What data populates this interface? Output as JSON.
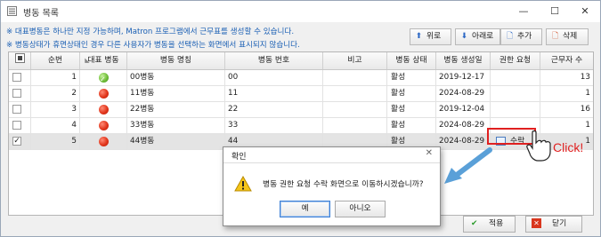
{
  "window": {
    "title": "병동 목록",
    "icon": "list-icon"
  },
  "notes": [
    "※ 대표병동은 하나만 지정 가능하며, Matron 프로그램에서 근무표를 생성할 수 있습니다.",
    "※ 병동상태가 휴면상태인 경우 다른 사용자가 병동을 선택하는 화면에서 표시되지 않습니다."
  ],
  "toolbar": {
    "up": "위로",
    "down": "아래로",
    "add": "추가",
    "delete": "삭제"
  },
  "table": {
    "headers": [
      "■",
      "순번",
      "대표 병동",
      "병동 명칭",
      "병동 번호",
      "비고",
      "병동 상태",
      "병동 생성일",
      "권한 요청",
      "근무자 수"
    ],
    "rows": [
      {
        "checked": false,
        "no": "1",
        "rep": "green",
        "name": "00병동",
        "ward_no": "00",
        "note": "",
        "status": "활성",
        "created": "2019-12-17",
        "request": "",
        "workers": "13"
      },
      {
        "checked": false,
        "no": "2",
        "rep": "red",
        "name": "11병동",
        "ward_no": "11",
        "note": "",
        "status": "활성",
        "created": "2024-08-29",
        "request": "",
        "workers": "1"
      },
      {
        "checked": false,
        "no": "3",
        "rep": "red",
        "name": "22병동",
        "ward_no": "22",
        "note": "",
        "status": "활성",
        "created": "2019-12-04",
        "request": "",
        "workers": "16"
      },
      {
        "checked": false,
        "no": "4",
        "rep": "red",
        "name": "33병동",
        "ward_no": "33",
        "note": "",
        "status": "활성",
        "created": "2024-08-29",
        "request": "",
        "workers": "1"
      },
      {
        "checked": true,
        "no": "5",
        "rep": "red",
        "name": "44병동",
        "ward_no": "44",
        "note": "",
        "status": "활성",
        "created": "2024-08-29",
        "request": "수락",
        "workers": "1"
      }
    ]
  },
  "dialog": {
    "title": "확인",
    "message": "병동 권한 요청 수락 화면으로 이동하시겠습니까?",
    "yes": "예",
    "no": "아니오",
    "icon": "warning-icon"
  },
  "footer": {
    "apply": "적용",
    "close": "닫기"
  },
  "annotation": {
    "click_text": "Click!"
  },
  "colors": {
    "note_blue": "#1a5fb4",
    "accent_red": "#e02020",
    "arrow_blue": "#5aa0d8"
  }
}
